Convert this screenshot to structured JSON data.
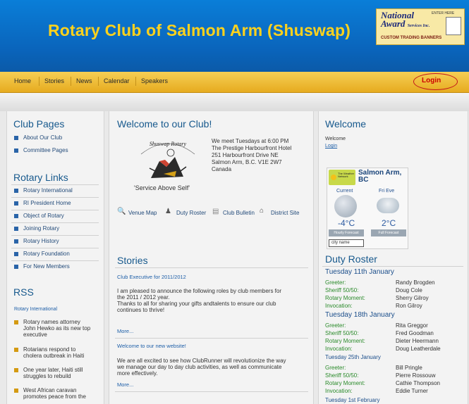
{
  "header": {
    "site_title": "Rotary Club of Salmon Arm (Shuswap)"
  },
  "badge": {
    "line1": "National",
    "line2": "Award",
    "services": "Services Inc.",
    "tagline": "CUSTOM TRADING BANNERS",
    "enter": "ENTER HERE"
  },
  "nav": {
    "items": [
      "Home",
      "Stories",
      "News",
      "Calendar",
      "Speakers"
    ],
    "login": "Login"
  },
  "left": {
    "club_pages_title": "Club Pages",
    "club_pages": [
      "About Our Club",
      "Committee Pages"
    ],
    "rotary_links_title": "Rotary Links",
    "rotary_links": [
      "Rotary International",
      "RI President Home",
      "Object of Rotary",
      "Joining Rotary",
      "Rotary History",
      "Rotary Foundation",
      "For New Members"
    ],
    "rss_title": "RSS",
    "rss_source": "Rotary International",
    "rss_items": [
      [
        "Rotary names attorney",
        "John Hewko as its new top",
        "executive"
      ],
      [
        "Rotarians respond to",
        "cholera outbreak in Haiti"
      ],
      [
        "One year later, Haiti still",
        "struggles to rebuild"
      ],
      [
        "West African caravan",
        "promotes peace from the"
      ]
    ]
  },
  "middle": {
    "welcome_title": "Welcome to our Club!",
    "logo_text": "Shuswap Rotary",
    "motto": "'Service Above Self'",
    "meeting": [
      "We meet Tuesdays at 6:00 PM",
      "The Prestige Harbourfront Hotel",
      "251 Harbourfront Drive NE",
      "Salmon Arm, B.C. V1E 2W7",
      "Canada"
    ],
    "links": {
      "venue_map": "Venue Map",
      "duty_roster": "Duty Roster",
      "club_bulletin": "Club Bulletin",
      "district_site": "District Site"
    },
    "stories_title": "Stories",
    "story1_title": "Club Executive for 2011/2012",
    "story1_body": [
      "I am pleased to announce the following roles by club members for",
      "the 2011 / 2012 year.",
      "Thanks to all for sharing your gifts andtalents to ensure our club",
      "continues to thrive!"
    ],
    "story1_more": "More...",
    "story2_title": "Welcome to our new website!",
    "story2_body": [
      "We are all excited to see how ClubRunner will revolutionize the way",
      "we manage our day to day club activities, as well as communicate",
      "more effectively."
    ],
    "story2_more": "More..."
  },
  "right": {
    "welcome_title": "Welcome",
    "welcome_text": "Welcome",
    "login_link": "Login",
    "weather": {
      "network": "The Weather Network",
      "city": "Salmon Arm,",
      "province": "BC",
      "current_label": "Current",
      "fri_label": "Fri Eve",
      "current_temp": "-4°C",
      "fri_temp": "2°C",
      "hourly": "Hourly Forecast",
      "full": "Full Forecast",
      "city_input": "city name"
    },
    "duty_title": "Duty Roster",
    "roster": [
      {
        "date": "Tuesday 11th January",
        "rows": [
          [
            "Greeter:",
            "Randy Brogden"
          ],
          [
            "Sheriff 50/50:",
            "Doug Cole"
          ],
          [
            "Rotary Moment:",
            "Sherry Gilroy"
          ],
          [
            "Invocation:",
            "Ron Gilroy"
          ]
        ]
      },
      {
        "date": "Tuesday 18th January",
        "rows": [
          [
            "Greeter:",
            "Rita Greggor"
          ],
          [
            "Sheriff 50/50:",
            "Fred Goodman"
          ],
          [
            "Rotary Moment:",
            "Dieter Heermann"
          ],
          [
            "Invocation:",
            "Doug Leatherdale"
          ]
        ]
      },
      {
        "date": "Tuesday 25th January",
        "rows": [
          [
            "Greeter:",
            "Bill Pringle"
          ],
          [
            "Sheriff 50/50:",
            "Pierre Rossouw"
          ],
          [
            "Rotary Moment:",
            "Cathie Thompson"
          ],
          [
            "Invocation:",
            "Eddie Turner"
          ]
        ]
      },
      {
        "date": "Tuesday 1st February",
        "rows": []
      }
    ]
  },
  "colors": {
    "banner": "#0a6fca",
    "title": "#ffd21c",
    "nav": "#eebd37",
    "heading": "#17598d",
    "login": "#c00000"
  }
}
